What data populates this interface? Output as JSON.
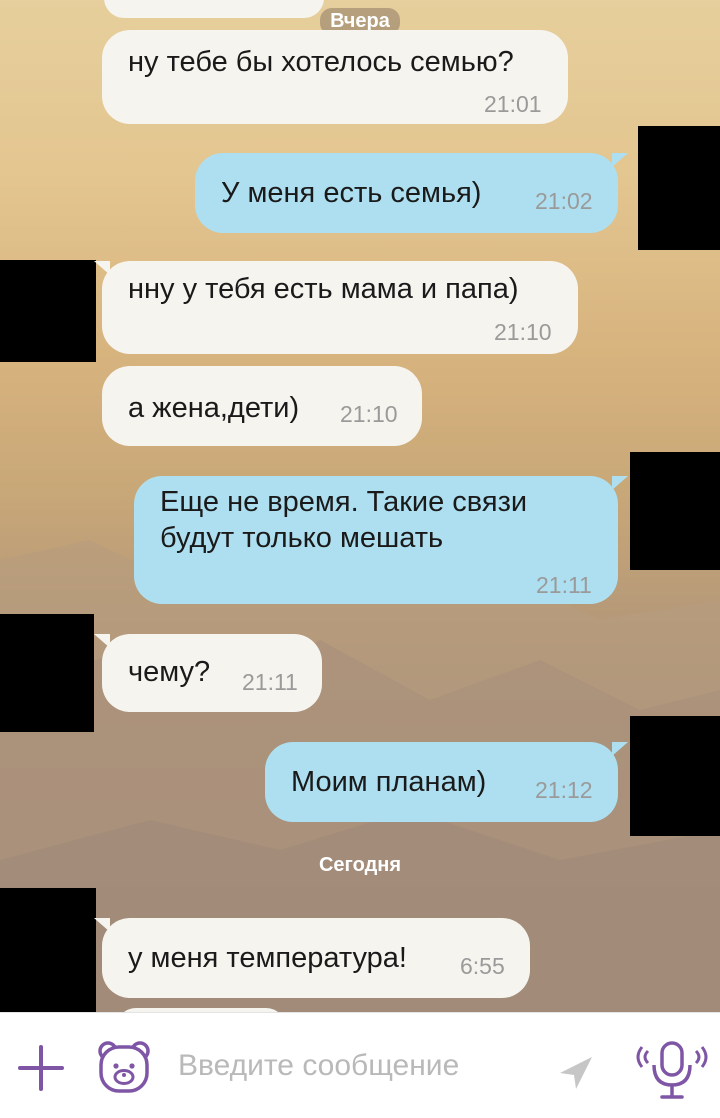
{
  "day_dividers": [
    "Вчера",
    "Сегодня"
  ],
  "messages": [
    {
      "dir": "in",
      "text": "ну тебе бы хотелось семью?",
      "time": "21:01"
    },
    {
      "dir": "out",
      "text": "У меня есть семья)",
      "time": "21:02"
    },
    {
      "dir": "in",
      "text": "нну у тебя есть мама и папа)",
      "time": "21:10"
    },
    {
      "dir": "in",
      "text": "а жена,дети)",
      "time": "21:10"
    },
    {
      "dir": "out",
      "text": "Еще не время. Такие связи\nбудут только мешать",
      "time": "21:11"
    },
    {
      "dir": "in",
      "text": "чему?",
      "time": "21:11"
    },
    {
      "dir": "out",
      "text": "Моим планам)",
      "time": "21:12"
    },
    {
      "dir": "in",
      "text": "у меня температура!",
      "time": "6:55"
    }
  ],
  "composer": {
    "placeholder": "Введите сообщение",
    "icons": [
      "plus-icon",
      "sticker-bear-icon",
      "send-arrow-icon",
      "voice-microphone-icon"
    ],
    "accent_color": "#7f56a6"
  },
  "colors": {
    "incoming_bubble": "#f6f4ef",
    "outgoing_bubble": "#aedff0",
    "time_text": "#9a9a9a"
  }
}
